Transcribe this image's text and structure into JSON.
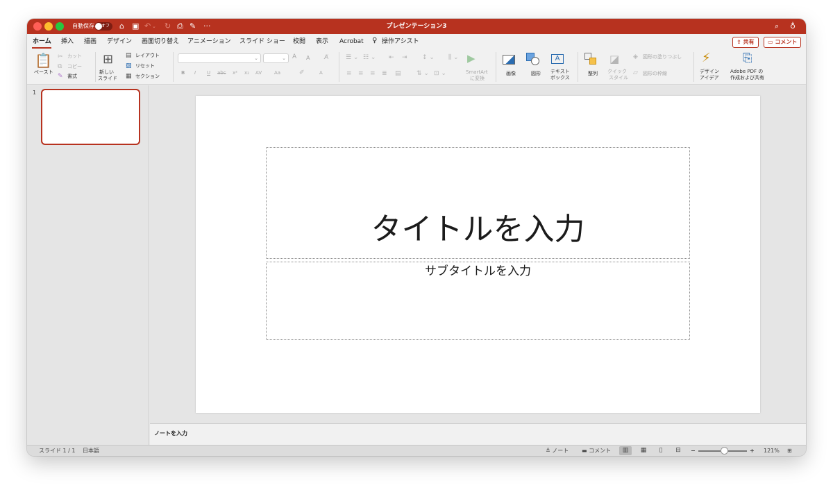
{
  "titlebar": {
    "autosave_label": "自動保存",
    "toggle_state": "オフ",
    "title": "プレゼンテーション3",
    "more": "···"
  },
  "tabs": [
    {
      "label": "ホーム",
      "active": true
    },
    {
      "label": "挿入"
    },
    {
      "label": "描画"
    },
    {
      "label": "デザイン"
    },
    {
      "label": "画面切り替え"
    },
    {
      "label": "アニメーション"
    },
    {
      "label": "スライド ショー"
    },
    {
      "label": "校閲"
    },
    {
      "label": "表示"
    },
    {
      "label": "Acrobat"
    }
  ],
  "tell_me": "操作アシスト",
  "header_buttons": {
    "share": "共有",
    "comment": "コメント"
  },
  "ribbon": {
    "paste": "ペースト",
    "cut": "カット",
    "copy": "コピー",
    "format": "書式",
    "new_slide_line1": "新しい",
    "new_slide_line2": "スライド",
    "layout": "レイアウト",
    "reset": "リセット",
    "section": "セクション",
    "font_size_up": "A",
    "font_size_down": "A",
    "bold": "B",
    "italic": "I",
    "underline": "U",
    "strike": "abc",
    "superscript": "x²",
    "subscript": "x₂",
    "char_spacing": "AV",
    "change_case": "Aa",
    "font_color": "A",
    "smartart_line1": "SmartArt",
    "smartart_line2": "に変換",
    "picture": "画像",
    "shapes": "図形",
    "textbox_line1": "テキスト",
    "textbox_line2": "ボックス",
    "textbox_icon": "A",
    "arrange": "整列",
    "quick_styles_line1": "クイック",
    "quick_styles_line2": "スタイル",
    "shape_fill": "図形の塗りつぶし",
    "shape_outline": "図形の枠線",
    "design_ideas_line1": "デザイン",
    "design_ideas_line2": "アイデア",
    "adobe_line1": "Adobe PDF の",
    "adobe_line2": "作成および共有"
  },
  "thumbnails": [
    {
      "number": "1"
    }
  ],
  "slide": {
    "title_placeholder": "タイトルを入力",
    "subtitle_placeholder": "サブタイトルを入力"
  },
  "notes_placeholder": "ノートを入力",
  "status": {
    "slide_position": "スライド 1 / 1",
    "language": "日本語",
    "notes": "ノート",
    "comments": "コメント",
    "zoom_minus": "−",
    "zoom_plus": "+",
    "zoom": "121%"
  },
  "colors": {
    "accent": "#b7321f",
    "ribbon_bg": "#f1f1f1",
    "canvas_bg": "#e5e5e5"
  },
  "icons": [
    "home-icon",
    "save-icon",
    "undo-icon",
    "redo-icon",
    "print-icon",
    "edit-icon",
    "search-icon",
    "account-icon",
    "lightbulb-icon"
  ]
}
